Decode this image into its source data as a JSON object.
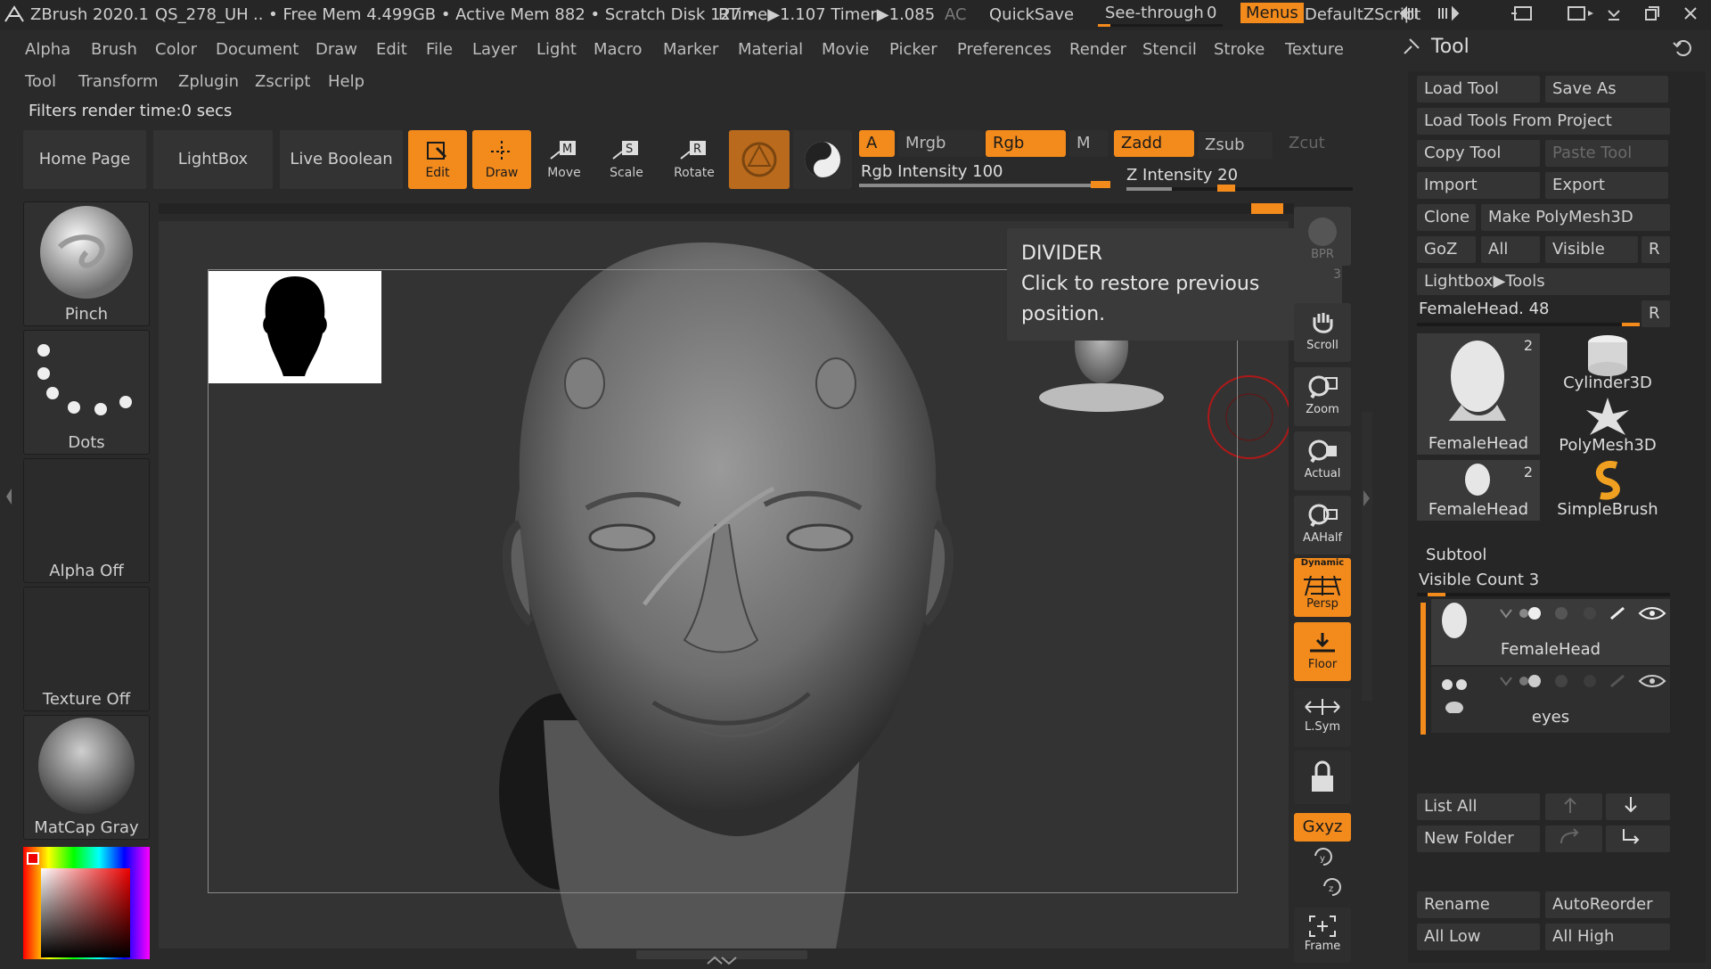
{
  "titlebar": {
    "app": "ZBrush 2020.1",
    "project": "QS_278_UH",
    "stats": ".. • Free Mem 4.499GB • Active Mem 882 • Scratch Disk 127 •",
    "rtime": "RTime▶1.107 Timer▶1.085",
    "ac": "AC",
    "quicksave": "QuickSave",
    "seethrough": "See-through",
    "seethrough_value": "0",
    "menus": "Menus",
    "script": "DefaultZScript"
  },
  "menus": {
    "row1": [
      "Alpha",
      "Brush",
      "Color",
      "Document",
      "Draw",
      "Edit",
      "File",
      "Layer",
      "Light",
      "Macro",
      "Marker",
      "Material",
      "Movie",
      "Picker",
      "Preferences",
      "Render",
      "Stencil",
      "Stroke",
      "Texture"
    ],
    "row2": [
      "Tool",
      "Transform",
      "Zplugin",
      "Zscript",
      "Help"
    ]
  },
  "status": "Filters render time:0 secs",
  "shelf": {
    "home": "Home Page",
    "lightbox": "LightBox",
    "liveboolean": "Live Boolean",
    "edit": "Edit",
    "draw": "Draw",
    "move": "Move",
    "scale": "Scale",
    "rotate": "Rotate",
    "a": "A",
    "mrgb": "Mrgb",
    "rgb": "Rgb",
    "m": "M",
    "zadd": "Zadd",
    "zsub": "Zsub",
    "zcut": "Zcut",
    "rgb_intensity": "Rgb Intensity 100",
    "z_intensity": "Z Intensity 20",
    "rgb_intensity_level": 1.0,
    "z_intensity_level": 0.2
  },
  "left": {
    "brush": "Pinch",
    "stroke": "Dots",
    "alpha": "Alpha Off",
    "texture": "Texture Off",
    "material": "MatCap Gray"
  },
  "tooltip": {
    "title": "DIVIDER",
    "body": "Click to restore previous position."
  },
  "rightshelf": {
    "bpr": "BPR",
    "spix": "3",
    "scroll": "Scroll",
    "zoom": "Zoom",
    "actual": "Actual",
    "aahalf": "AAHalf",
    "dynamic": "Dynamic",
    "persp": "Persp",
    "floor": "Floor",
    "lsym": "L.Sym",
    "xyz": "Gxyz",
    "frame": "Frame"
  },
  "tool": {
    "title": "Tool",
    "load_tool": "Load Tool",
    "save_as": "Save As",
    "load_from_project": "Load Tools From Project",
    "copy_tool": "Copy Tool",
    "paste_tool": "Paste Tool",
    "import": "Import",
    "export": "Export",
    "clone": "Clone",
    "make_polymesh": "Make PolyMesh3D",
    "goz": "GoZ",
    "all": "All",
    "visible": "Visible",
    "r": "R",
    "lightbox_tools": "Lightbox▶Tools",
    "current_tool": "FemaleHead. 48",
    "thumbs": [
      {
        "label": "FemaleHead",
        "badge": "2"
      },
      {
        "label": "Cylinder3D",
        "badge": ""
      },
      {
        "label": "PolyMesh3D",
        "badge": ""
      },
      {
        "label": "FemaleHead",
        "badge": "2"
      },
      {
        "label": "SimpleBrush",
        "badge": ""
      }
    ],
    "subtool": {
      "title": "Subtool",
      "visible_count": "Visible Count 3",
      "items": [
        "FemaleHead",
        "eyes"
      ],
      "list_all": "List All",
      "new_folder": "New Folder",
      "rename": "Rename",
      "autoreorder": "AutoReorder",
      "all_low": "All Low",
      "all_high": "All High"
    }
  },
  "colors": {
    "accent": "#f28a1c",
    "panel": "#2a2a2a",
    "canvas": "#333333"
  }
}
